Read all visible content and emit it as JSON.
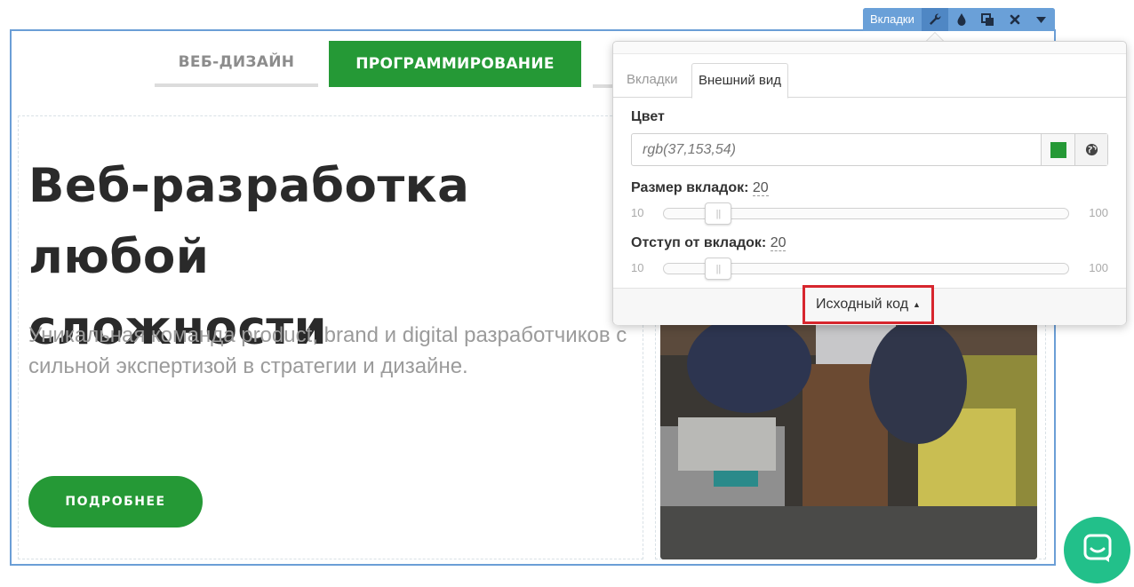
{
  "toolbar": {
    "label": "Вкладки",
    "icons": [
      "wrench-icon",
      "drop-icon",
      "duplicate-icon",
      "close-icon",
      "caret-down-icon"
    ]
  },
  "page_tabs": [
    {
      "label": "ВЕБ-ДИЗАЙН",
      "state": "inactive"
    },
    {
      "label": "ПРОГРАММИРОВАНИЕ",
      "state": "active"
    }
  ],
  "hero": {
    "title_line1": "Веб-разработка любой",
    "title_line2": "сложности",
    "description": "Уникальная команда product, brand и digital разработчиков с сильной экспертизой в стратегии и дизайне.",
    "cta_label": "ПОДРОБНЕЕ"
  },
  "panel": {
    "tabs": [
      {
        "label": "Вкладки",
        "state": "inactive"
      },
      {
        "label": "Внешний вид",
        "state": "active"
      }
    ],
    "color": {
      "label": "Цвет",
      "value": "rgb(37,153,54)",
      "swatch": "#259936"
    },
    "tab_size": {
      "label": "Размер вкладок",
      "value": "20",
      "min": "10",
      "max": "100",
      "current": 20
    },
    "tab_offset": {
      "label": "Отступ от вкладок",
      "value": "20",
      "min": "10",
      "max": "100",
      "current": 20
    },
    "source_button": "Исходный код"
  },
  "colors": {
    "accent": "#259936",
    "selection": "#6aa0d8",
    "highlight": "#d7262e",
    "chat": "#22c08a"
  }
}
